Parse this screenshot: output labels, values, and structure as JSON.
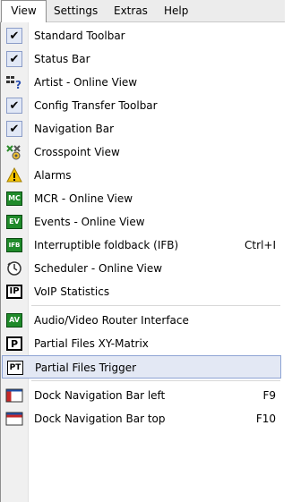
{
  "menubar": {
    "items": [
      "View",
      "Settings",
      "Extras",
      "Help"
    ]
  },
  "menu": {
    "items": [
      {
        "label": "Standard Toolbar",
        "checked": true,
        "icon": "check-icon"
      },
      {
        "label": "Status Bar",
        "checked": true,
        "icon": "check-icon"
      },
      {
        "label": "Artist - Online View",
        "icon": "artist-view-icon"
      },
      {
        "label": "Config Transfer Toolbar",
        "checked": true,
        "icon": "check-icon"
      },
      {
        "label": "Navigation Bar",
        "checked": true,
        "icon": "check-icon"
      },
      {
        "label": "Crosspoint View",
        "icon": "crosspoint-icon"
      },
      {
        "label": "Alarms",
        "icon": "alarm-icon"
      },
      {
        "label": "MCR - Online View",
        "icon": "mcr-icon",
        "icon_text": "MC"
      },
      {
        "label": "Events - Online View",
        "icon": "events-icon",
        "icon_text": "EV"
      },
      {
        "label": "Interruptible foldback (IFB)",
        "shortcut": "Ctrl+I",
        "icon": "ifb-icon",
        "icon_text": "IFB"
      },
      {
        "label": "Scheduler - Online View",
        "icon": "scheduler-icon"
      },
      {
        "label": "VoIP Statistics",
        "icon": "voip-icon",
        "icon_text": "IP"
      },
      {
        "label": "Audio/Video Router Interface",
        "icon": "av-router-icon",
        "icon_text": "AV"
      },
      {
        "label": "Partial Files XY-Matrix",
        "icon": "partial-matrix-icon",
        "icon_text": "P"
      },
      {
        "label": "Partial Files Trigger",
        "icon": "partial-trigger-icon",
        "icon_text": "PT",
        "highlighted": true
      },
      {
        "label": "Dock Navigation Bar left",
        "shortcut": "F9",
        "icon": "dock-left-icon"
      },
      {
        "label": "Dock Navigation Bar top",
        "shortcut": "F10",
        "icon": "dock-top-icon"
      }
    ]
  }
}
